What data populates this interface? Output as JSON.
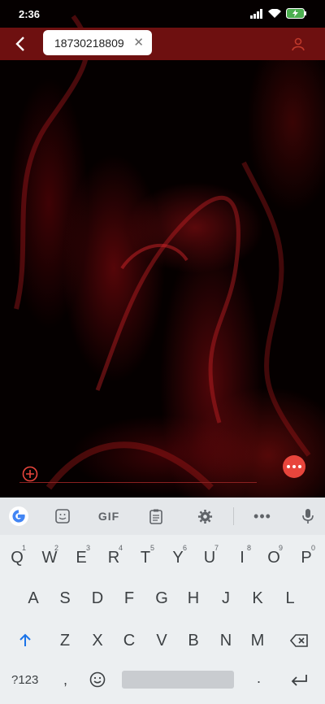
{
  "status_bar": {
    "time": "2:36"
  },
  "conversation": {
    "recipient": "18730218809"
  },
  "keyboard": {
    "row1": [
      "Q",
      "W",
      "E",
      "R",
      "T",
      "Y",
      "U",
      "I",
      "O",
      "P"
    ],
    "row1_hints": [
      "1",
      "2",
      "3",
      "4",
      "5",
      "6",
      "7",
      "8",
      "9",
      "0"
    ],
    "row2": [
      "A",
      "S",
      "D",
      "F",
      "G",
      "H",
      "J",
      "K",
      "L"
    ],
    "row3": [
      "Z",
      "X",
      "C",
      "V",
      "B",
      "N",
      "M"
    ],
    "gif_label": "GIF",
    "symbols_label": "?123",
    "comma": ",",
    "period": "."
  },
  "colors": {
    "accent": "#e8453c",
    "topbar": "#6e1010",
    "shift": "#1a73e8"
  }
}
